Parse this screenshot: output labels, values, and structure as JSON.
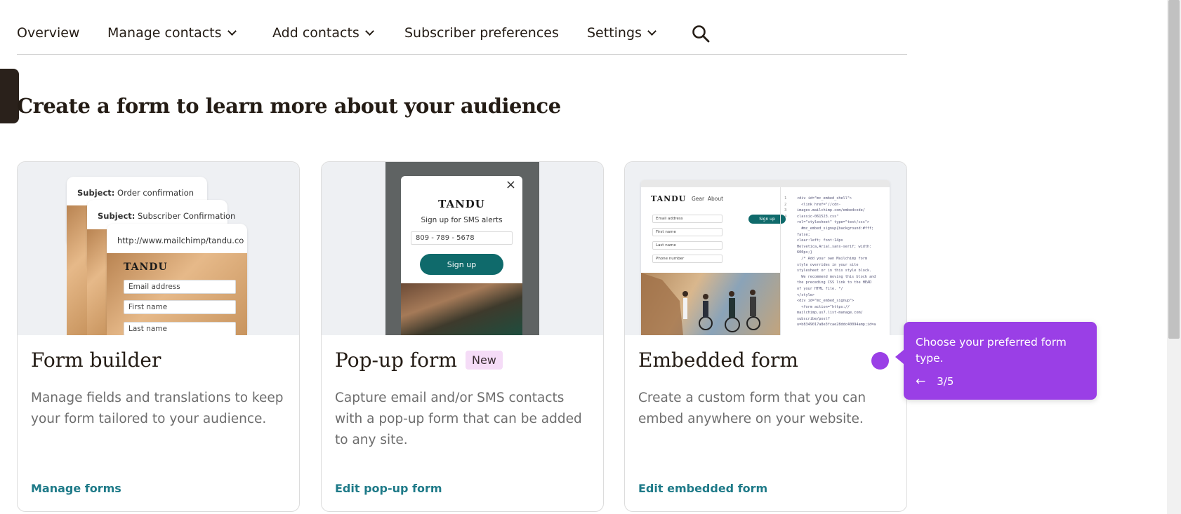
{
  "nav": {
    "items": [
      {
        "label": "Overview"
      },
      {
        "label": "Manage contacts"
      },
      {
        "label": "Add contacts"
      },
      {
        "label": "Subscriber preferences"
      },
      {
        "label": "Settings"
      }
    ],
    "search_icon": "search-icon"
  },
  "page_title": "Create a form to learn more about your audience",
  "cards": [
    {
      "title": "Form builder",
      "desc": "Manage fields and translations to keep your form tailored to your audience.",
      "link": "Manage forms",
      "illustration": {
        "env1_label": "Subject:",
        "env1_text": " Order confirmation",
        "env2_label": "Subject:",
        "env2_text": " Subscriber Confirmation",
        "url": "http://www.mailchimp/tandu.co",
        "brand": "TANDU",
        "fields": [
          "Email address",
          "First name",
          "Last name"
        ]
      }
    },
    {
      "title": "Pop-up form",
      "badge": "New",
      "desc": "Capture email and/or SMS contacts with a pop-up form that can be added to any site.",
      "link": "Edit pop-up form",
      "illustration": {
        "close": "×",
        "brand": "TANDU",
        "caption": "Sign up for SMS alerts",
        "phone": "809 - 789 - 5678",
        "button": "Sign up"
      }
    },
    {
      "title": "Embedded form",
      "desc": "Create a custom form that you can embed anywhere on your website.",
      "link": "Edit embedded form",
      "illustration": {
        "brand": "TANDU",
        "menu": "Gear  About",
        "fields": [
          "Email address",
          "First name",
          "Last name",
          "Phone number"
        ],
        "button": "Sign up",
        "line_numbers": "1\n2\n3\n4",
        "code": "<div id=\"mc_embed_shell\">\n  <link href=\"//cdn-\nimages.mailchimp.com/embedcode/\nclassic-061523.css\"\nrel=\"stylesheet\" type=\"text/css\">\n  #mc_embed_signup{background:#fff;\nfalse;\nclear:left; font:14px\nHelvetica,Arial,sans-serif; width:\n600px;}\n  /* Add your own Mailchimp form\nstyle overrides in your site\nstylesheet or in this style block.\n  We recommend moving this block and\nthe preceding CSS link to the HEAD\nof your HTML file. */\n</style>\n<div id=\"mc_embed_signup\">\n  <form action=\"https://\nmailchimp.us7.list-manage.com/\nsubscribe/post?\nu=b8349017a8e3fcae28ddc40094amp;id=a"
      }
    }
  ],
  "tooltip": {
    "text": "Choose your preferred form type.",
    "back": "←",
    "step": "3/5"
  },
  "colors": {
    "accent": "#9a3fe6",
    "link": "#1e7a88",
    "badge_bg": "#f5dcf7",
    "button_teal": "#0f6a6b"
  }
}
